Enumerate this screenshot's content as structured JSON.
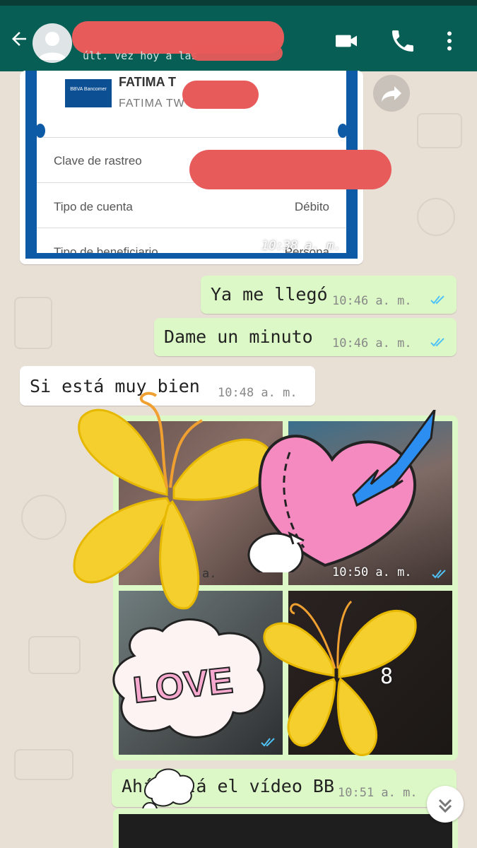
{
  "header": {
    "contact_name": "",
    "last_seen": "últ. vez hoy a las"
  },
  "bank_card": {
    "bank_logo": "BBVA Bancomer",
    "beneficiary_name": "FATIMA T",
    "beneficiary_sub": "FATIMA TW TW",
    "rows": [
      {
        "label": "Clave de rastreo",
        "value": ""
      },
      {
        "label": "Tipo de cuenta",
        "value": "Débito"
      },
      {
        "label": "Tipo de beneficiario",
        "value": "Persona"
      }
    ],
    "time": "10:38 a.  m."
  },
  "messages": [
    {
      "text": "Ya me llegó",
      "time": "10:46 a.  m.",
      "direction": "out"
    },
    {
      "text": "Dame un minuto",
      "time": "10:46 a.  m.",
      "direction": "out"
    },
    {
      "text": "Si está muy bien",
      "time": "10:48 a.  m.",
      "direction": "in"
    },
    {
      "text": "Ahí está el vídeo BB",
      "time": "10:51 a.  m.",
      "direction": "out"
    }
  ],
  "media_grid": {
    "times": [
      "10:50 a.  m.",
      "a."
    ],
    "overlay_number": "8"
  },
  "stickers": {
    "love_text": "LOVE"
  },
  "colors": {
    "header": "#075e54",
    "outgoing_bubble": "#dcf8c6",
    "incoming_bubble": "#ffffff",
    "read_ticks": "#4fc3f7",
    "redaction": "#e85b5b"
  },
  "icons": [
    "back-arrow-icon",
    "avatar-icon",
    "video-call-icon",
    "phone-icon",
    "more-vert-icon",
    "forward-icon",
    "double-check-icon",
    "chevron-double-down-icon"
  ]
}
